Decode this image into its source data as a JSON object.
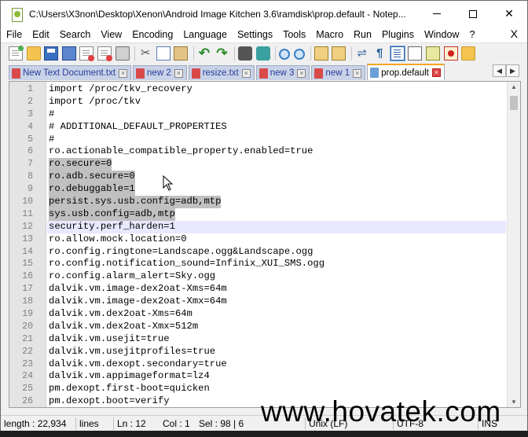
{
  "window": {
    "title": "C:\\Users\\X3non\\Desktop\\Xenon\\Android Image Kitchen 3.6\\ramdisk\\prop.default - Notep...",
    "minimize": "minimize",
    "maximize": "maximize",
    "close": "✕"
  },
  "menu": {
    "items": [
      "File",
      "Edit",
      "Search",
      "View",
      "Encoding",
      "Language",
      "Settings",
      "Tools",
      "Macro",
      "Run",
      "Plugins",
      "Window",
      "?"
    ],
    "close_label": "X"
  },
  "toolbar": {
    "icons": [
      "new-icon",
      "open-icon",
      "save-icon",
      "save-all-icon",
      "close-icon",
      "close-all-icon",
      "print-icon",
      "cut-icon",
      "copy-icon",
      "paste-icon",
      "undo-icon",
      "redo-icon",
      "find-icon",
      "replace-icon",
      "zoom-in-icon",
      "zoom-out-icon",
      "sync-vertical-icon",
      "sync-horizontal-icon",
      "word-wrap-icon",
      "show-all-chars-icon",
      "indent-guide-icon",
      "function-list-icon",
      "document-map-icon",
      "macro-record-icon",
      "folder-workspace-icon"
    ]
  },
  "tabs": [
    {
      "label": "New Text Document.txt",
      "active": false
    },
    {
      "label": "new 2",
      "active": false
    },
    {
      "label": "resize.txt",
      "active": false
    },
    {
      "label": "new 3",
      "active": false
    },
    {
      "label": "new 1",
      "active": false
    },
    {
      "label": "prop.default",
      "active": true
    }
  ],
  "tab_nav": {
    "left": "◀",
    "right": "▶"
  },
  "editor": {
    "lines": [
      {
        "n": "1",
        "text": "import /proc/tkv_recovery",
        "selected": false
      },
      {
        "n": "2",
        "text": "import /proc/tkv",
        "selected": false
      },
      {
        "n": "3",
        "text": "#",
        "selected": false
      },
      {
        "n": "4",
        "text": "# ADDITIONAL_DEFAULT_PROPERTIES",
        "selected": false
      },
      {
        "n": "5",
        "text": "#",
        "selected": false
      },
      {
        "n": "6",
        "text": "ro.actionable_compatible_property.enabled=true",
        "selected": false
      },
      {
        "n": "7",
        "text": "ro.secure=0",
        "selected": true
      },
      {
        "n": "8",
        "text": "ro.adb.secure=0",
        "selected": true
      },
      {
        "n": "9",
        "text": "ro.debuggable=1",
        "selected": true
      },
      {
        "n": "10",
        "text": "persist.sys.usb.config=adb,mtp",
        "selected": true
      },
      {
        "n": "11",
        "text": "sys.usb.config=adb,mtp",
        "selected": true
      },
      {
        "n": "12",
        "text": "security.perf_harden=1",
        "selected": false,
        "current": true
      },
      {
        "n": "13",
        "text": "ro.allow.mock.location=0",
        "selected": false
      },
      {
        "n": "14",
        "text": "ro.config.ringtone=Landscape.ogg&Landscape.ogg",
        "selected": false
      },
      {
        "n": "15",
        "text": "ro.config.notification_sound=Infinix_XUI_SMS.ogg",
        "selected": false
      },
      {
        "n": "16",
        "text": "ro.config.alarm_alert=Sky.ogg",
        "selected": false
      },
      {
        "n": "17",
        "text": "dalvik.vm.image-dex2oat-Xms=64m",
        "selected": false
      },
      {
        "n": "18",
        "text": "dalvik.vm.image-dex2oat-Xmx=64m",
        "selected": false
      },
      {
        "n": "19",
        "text": "dalvik.vm.dex2oat-Xms=64m",
        "selected": false
      },
      {
        "n": "20",
        "text": "dalvik.vm.dex2oat-Xmx=512m",
        "selected": false
      },
      {
        "n": "21",
        "text": "dalvik.vm.usejit=true",
        "selected": false
      },
      {
        "n": "22",
        "text": "dalvik.vm.usejitprofiles=true",
        "selected": false
      },
      {
        "n": "23",
        "text": "dalvik.vm.dexopt.secondary=true",
        "selected": false
      },
      {
        "n": "24",
        "text": "dalvik.vm.appimageformat=lz4",
        "selected": false
      },
      {
        "n": "25",
        "text": "pm.dexopt.first-boot=quicken",
        "selected": false
      },
      {
        "n": "26",
        "text": "pm.dexopt.boot=verify",
        "selected": false
      }
    ]
  },
  "status": {
    "length": "length : 22,934",
    "lines": "lines",
    "ln": "Ln : 12",
    "col": "Col : 1",
    "sel": "Sel : 98 | 6",
    "eol": "Unix (LF)",
    "encoding": "UTF-8",
    "mode": "INS"
  },
  "watermark": "www.hovatek.com",
  "colors": {
    "selection": "#c0c0c0",
    "current_line": "#e8e8ff",
    "active_tab_accent": "#f5a623",
    "inactive_tab": "#c8d3e8"
  }
}
